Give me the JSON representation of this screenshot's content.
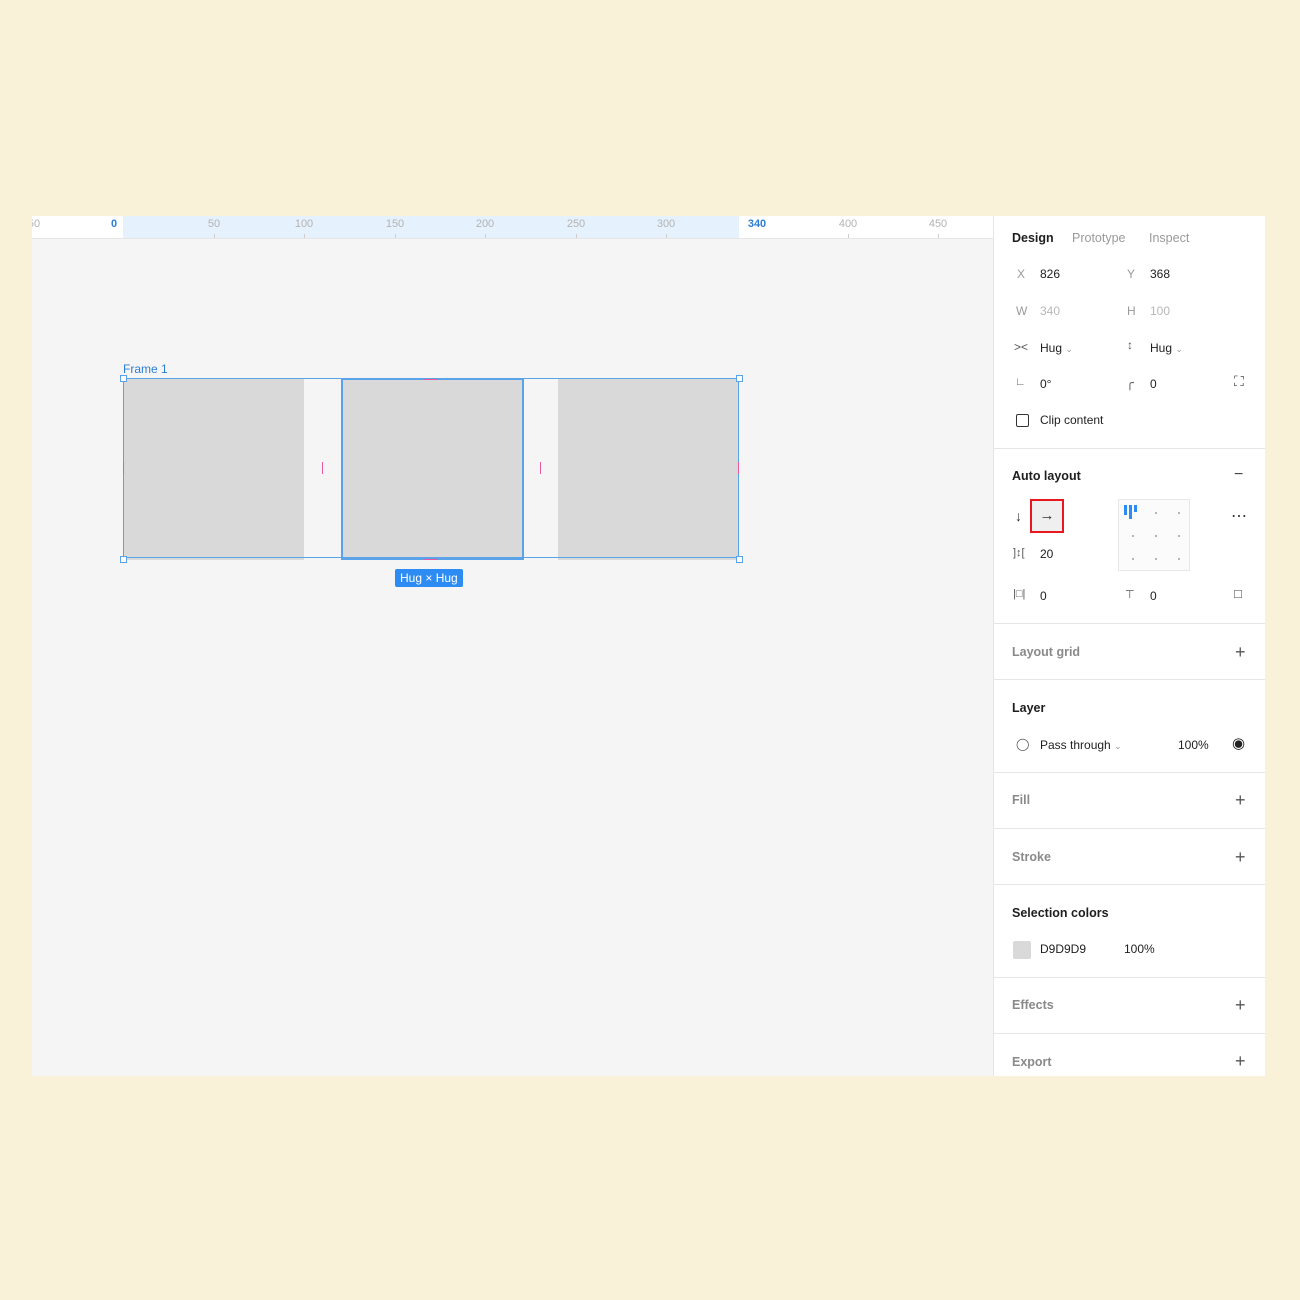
{
  "ruler": {
    "ticks": [
      "50",
      "0",
      "50",
      "100",
      "150",
      "200",
      "250",
      "300",
      "340",
      "400",
      "450"
    ]
  },
  "canvas": {
    "frame_label": "Frame 1",
    "size_badge": "Hug × Hug"
  },
  "panel": {
    "tabs": [
      "Design",
      "Prototype",
      "Inspect"
    ],
    "position": {
      "x_label": "X",
      "x_value": "826",
      "y_label": "Y",
      "y_value": "368",
      "w_label": "W",
      "w_value": "340",
      "h_label": "H",
      "h_value": "100"
    },
    "resizing": {
      "horizontal": "Hug",
      "vertical": "Hug"
    },
    "rotation": "0°",
    "corner_radius": "0",
    "clip_content_label": "Clip content",
    "clip_content_checked": false,
    "auto_layout": {
      "title": "Auto layout",
      "direction": "horizontal",
      "vertical_arrow": "↓",
      "horizontal_arrow": "→",
      "spacing": "20",
      "padding_horizontal": "0",
      "padding_vertical": "0",
      "alignment": "top-left"
    },
    "layout_grid": {
      "title": "Layout grid"
    },
    "layer": {
      "title": "Layer",
      "blend_mode": "Pass through",
      "opacity": "100%"
    },
    "fill": {
      "title": "Fill"
    },
    "stroke": {
      "title": "Stroke"
    },
    "selection_colors": {
      "title": "Selection colors",
      "hex": "D9D9D9",
      "opacity": "100%",
      "swatch_color": "#D9D9D9"
    },
    "effects": {
      "title": "Effects"
    },
    "export": {
      "title": "Export"
    }
  },
  "colors": {
    "accent": "#2C8CF4",
    "highlight_box": "#E8191E",
    "page_background": "#FAF2D8",
    "child_fill": "#D9D9D9"
  }
}
